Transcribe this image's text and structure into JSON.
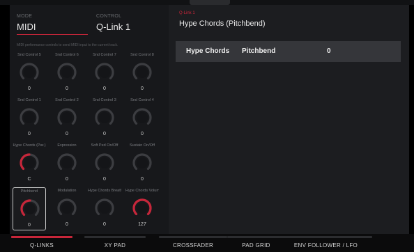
{
  "header": {
    "mode_label": "MODE",
    "mode_value": "MIDI",
    "control_label": "CONTROL",
    "control_value": "Q-Link 1",
    "help_text": "MIDI performance controls to send MIDI input to the current track.",
    "accent_color": "#c7263a"
  },
  "knobs": [
    {
      "label": "Snd Control 5",
      "value": "0",
      "level": 0,
      "active": false,
      "selected": false
    },
    {
      "label": "Snd Control 6",
      "value": "0",
      "level": 0,
      "active": false,
      "selected": false
    },
    {
      "label": "Snd Control 7",
      "value": "0",
      "level": 0,
      "active": false,
      "selected": false
    },
    {
      "label": "Snd Control 8",
      "value": "0",
      "level": 0,
      "active": false,
      "selected": false
    },
    {
      "label": "Snd Control 1",
      "value": "0",
      "level": 0,
      "active": false,
      "selected": false
    },
    {
      "label": "Snd Control 2",
      "value": "0",
      "level": 0,
      "active": false,
      "selected": false
    },
    {
      "label": "Snd Control 3",
      "value": "0",
      "level": 0,
      "active": false,
      "selected": false
    },
    {
      "label": "Snd Control 4",
      "value": "0",
      "level": 0,
      "active": false,
      "selected": false
    },
    {
      "label": "Hype Chords (Par.)",
      "value": "C",
      "level": 0.5,
      "active": true,
      "selected": false
    },
    {
      "label": "Expression",
      "value": "0",
      "level": 0,
      "active": false,
      "selected": false
    },
    {
      "label": "Soft Ped On/Off",
      "value": "0",
      "level": 0,
      "active": false,
      "selected": false
    },
    {
      "label": "Sustain On/Off",
      "value": "0",
      "level": 0,
      "active": false,
      "selected": false
    },
    {
      "label": "Pitchbend",
      "value": "0",
      "level": 0.5,
      "active": true,
      "selected": true
    },
    {
      "label": "Modulation",
      "value": "0",
      "level": 0,
      "active": false,
      "selected": false
    },
    {
      "label": "Hype Chords Breath",
      "value": "0",
      "level": 0,
      "active": false,
      "selected": false
    },
    {
      "label": "Hype Chords Volume",
      "value": "127",
      "level": 1,
      "active": true,
      "selected": false
    }
  ],
  "detail": {
    "tag": "Q-Link 1",
    "title": "Hype Chords (Pitchbend)",
    "param_name": "Hype Chords",
    "param_type": "Pitchbend",
    "param_value": "0"
  },
  "tabs": [
    {
      "label": "Q-LINKS",
      "active": true
    },
    {
      "label": "XY PAD",
      "active": false
    },
    {
      "label": "CROSSFADER",
      "active": false
    },
    {
      "label": "PAD GRID",
      "active": false
    },
    {
      "label": "ENV FOLLOWER / LFO",
      "active": false
    }
  ]
}
